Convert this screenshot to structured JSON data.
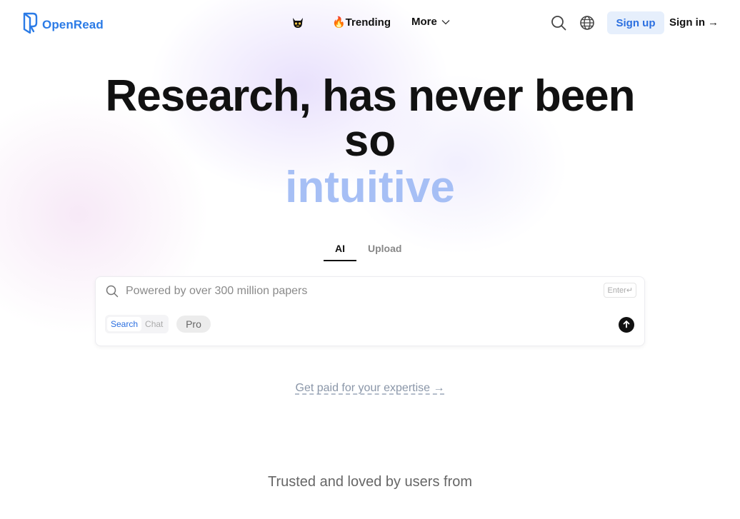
{
  "brand": {
    "name": "OpenRead"
  },
  "nav": {
    "trending_label": "🔥Trending",
    "more_label": "More",
    "signup_label": "Sign up",
    "signin_label": "Sign in",
    "signin_arrow": "→"
  },
  "hero": {
    "line1": "Research, has never been",
    "line2": "so",
    "line3": "intuitive"
  },
  "tabs": [
    {
      "label": "AI",
      "active": true
    },
    {
      "label": "Upload",
      "active": false
    }
  ],
  "search": {
    "placeholder": "Powered by over 300 million papers",
    "enter_hint": "Enter↵",
    "modes": [
      {
        "label": "Search",
        "active": true
      },
      {
        "label": "Chat",
        "active": false
      }
    ],
    "pro_label": "Pro"
  },
  "links": {
    "paid": "Get paid for your expertise →"
  },
  "footer": {
    "trusted": "Trusted and loved by users from"
  },
  "colors": {
    "accent": "#2b7be6",
    "hero_highlight": "#a6bff5",
    "signup_bg": "#e6effc"
  },
  "icons": [
    "openread-logo-icon",
    "mascot-icon",
    "chevron-down-icon",
    "search-icon",
    "globe-icon",
    "arrow-up-icon"
  ]
}
